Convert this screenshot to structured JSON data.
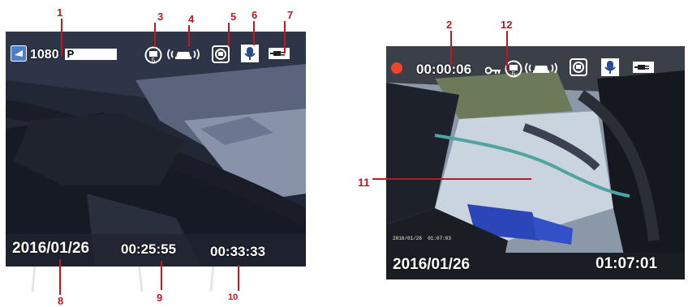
{
  "left_screen": {
    "resolution": "1080",
    "resolution_suffix": "P",
    "date": "2016/01/26",
    "elapsed": "00:25:55",
    "remaining": "00:33:33"
  },
  "right_screen": {
    "timer": "00:00:06",
    "stamp": "2016/01/26  01:07:03",
    "date": "2016/01/26",
    "time": "01:07:01"
  },
  "callouts": [
    "1",
    "2",
    "3",
    "4",
    "5",
    "6",
    "7",
    "8",
    "9",
    "10",
    "11",
    "12"
  ],
  "colors": {
    "callout": "#c0181f",
    "record_dot": "#f0452b",
    "osd_text": "#ffffff"
  },
  "icons": [
    "camera-icon",
    "loop-record-icon",
    "motion-detect-icon",
    "gsensor-icon",
    "microphone-icon",
    "power-plug-icon",
    "record-dot-icon",
    "key-lock-icon"
  ]
}
